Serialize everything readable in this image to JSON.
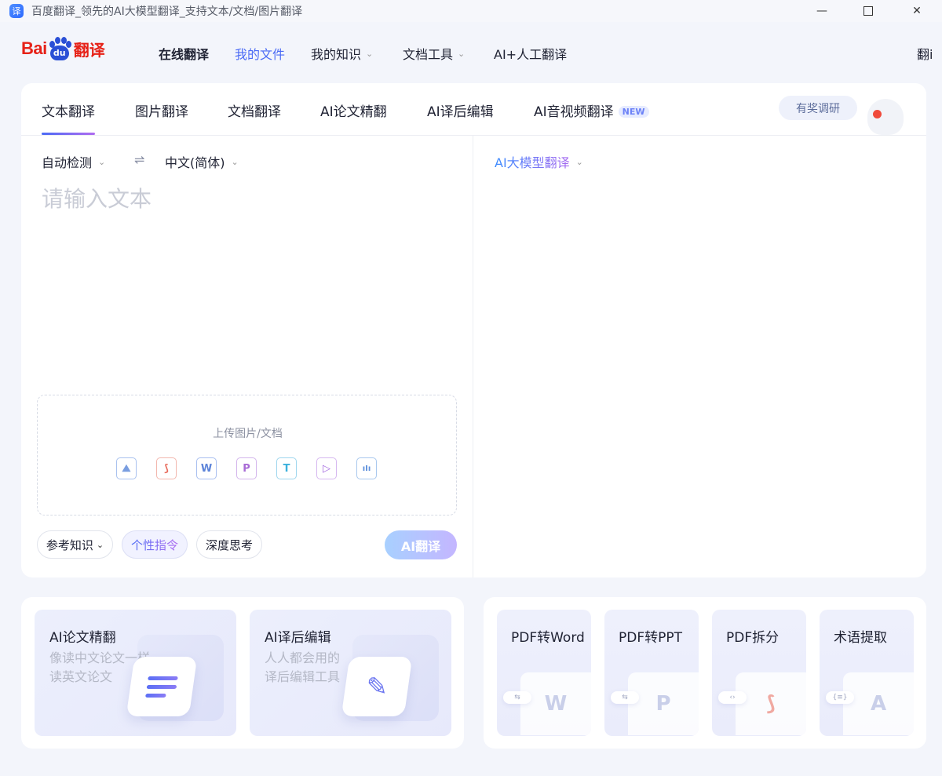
{
  "window": {
    "title": "百度翻译_领先的AI大模型翻译_支持文本/文档/图片翻译",
    "app_icon": "译",
    "controls": {
      "minimize": "—",
      "maximize": "",
      "close": "✕"
    }
  },
  "logo": {
    "bai": "Bai",
    "du": "du",
    "fanyi": "翻译"
  },
  "nav": {
    "online": "在线翻译",
    "my_files": "我的文件",
    "my_knowledge": "我的知识",
    "doc_tools": "文档工具",
    "human_ai": "AI+人工翻译",
    "cut_off": "翻i"
  },
  "tabs": {
    "text": "文本翻译",
    "image": "图片翻译",
    "document": "文档翻译",
    "paper": "AI论文精翻",
    "post_edit": "AI译后编辑",
    "av": "AI音视频翻译",
    "new_badge": "NEW",
    "survey": "有奖调研"
  },
  "lang": {
    "source": "自动检测",
    "swap": "⇌",
    "target": "中文(简体)",
    "chev": "⌄"
  },
  "input": {
    "placeholder": "请输入文本"
  },
  "model": {
    "label": "AI大模型翻译"
  },
  "upload": {
    "label": "上传图片/文档",
    "icons": {
      "image": "⛰",
      "pdf": "⟆",
      "word": "W",
      "ppt": "P",
      "txt": "T",
      "video": "▷",
      "audio": "ıIı"
    }
  },
  "chips": {
    "reference": "参考知识",
    "persona": "个性指令",
    "deep": "深度思考"
  },
  "ai_translate": "AI翻译",
  "promo": {
    "paper": {
      "title": "AI论文精翻",
      "line1": "像读中文论文一样",
      "line2": "读英文论文"
    },
    "edit": {
      "title": "AI译后编辑",
      "line1": "人人都会用的",
      "line2": "译后编辑工具"
    }
  },
  "tools": {
    "pdf_word": {
      "title": "PDF转Word",
      "glyph": "W",
      "badge": "⇆"
    },
    "pdf_ppt": {
      "title": "PDF转PPT",
      "glyph": "P",
      "badge": "⇆"
    },
    "pdf_split": {
      "title": "PDF拆分",
      "glyph": "⟆",
      "badge": "‹›"
    },
    "terms": {
      "title": "术语提取",
      "glyph": "A",
      "badge": "{≡}"
    }
  },
  "colors": {
    "accent": "#4b6bf5",
    "brand_red": "#e62117",
    "brand_blue": "#2a4fd6"
  }
}
